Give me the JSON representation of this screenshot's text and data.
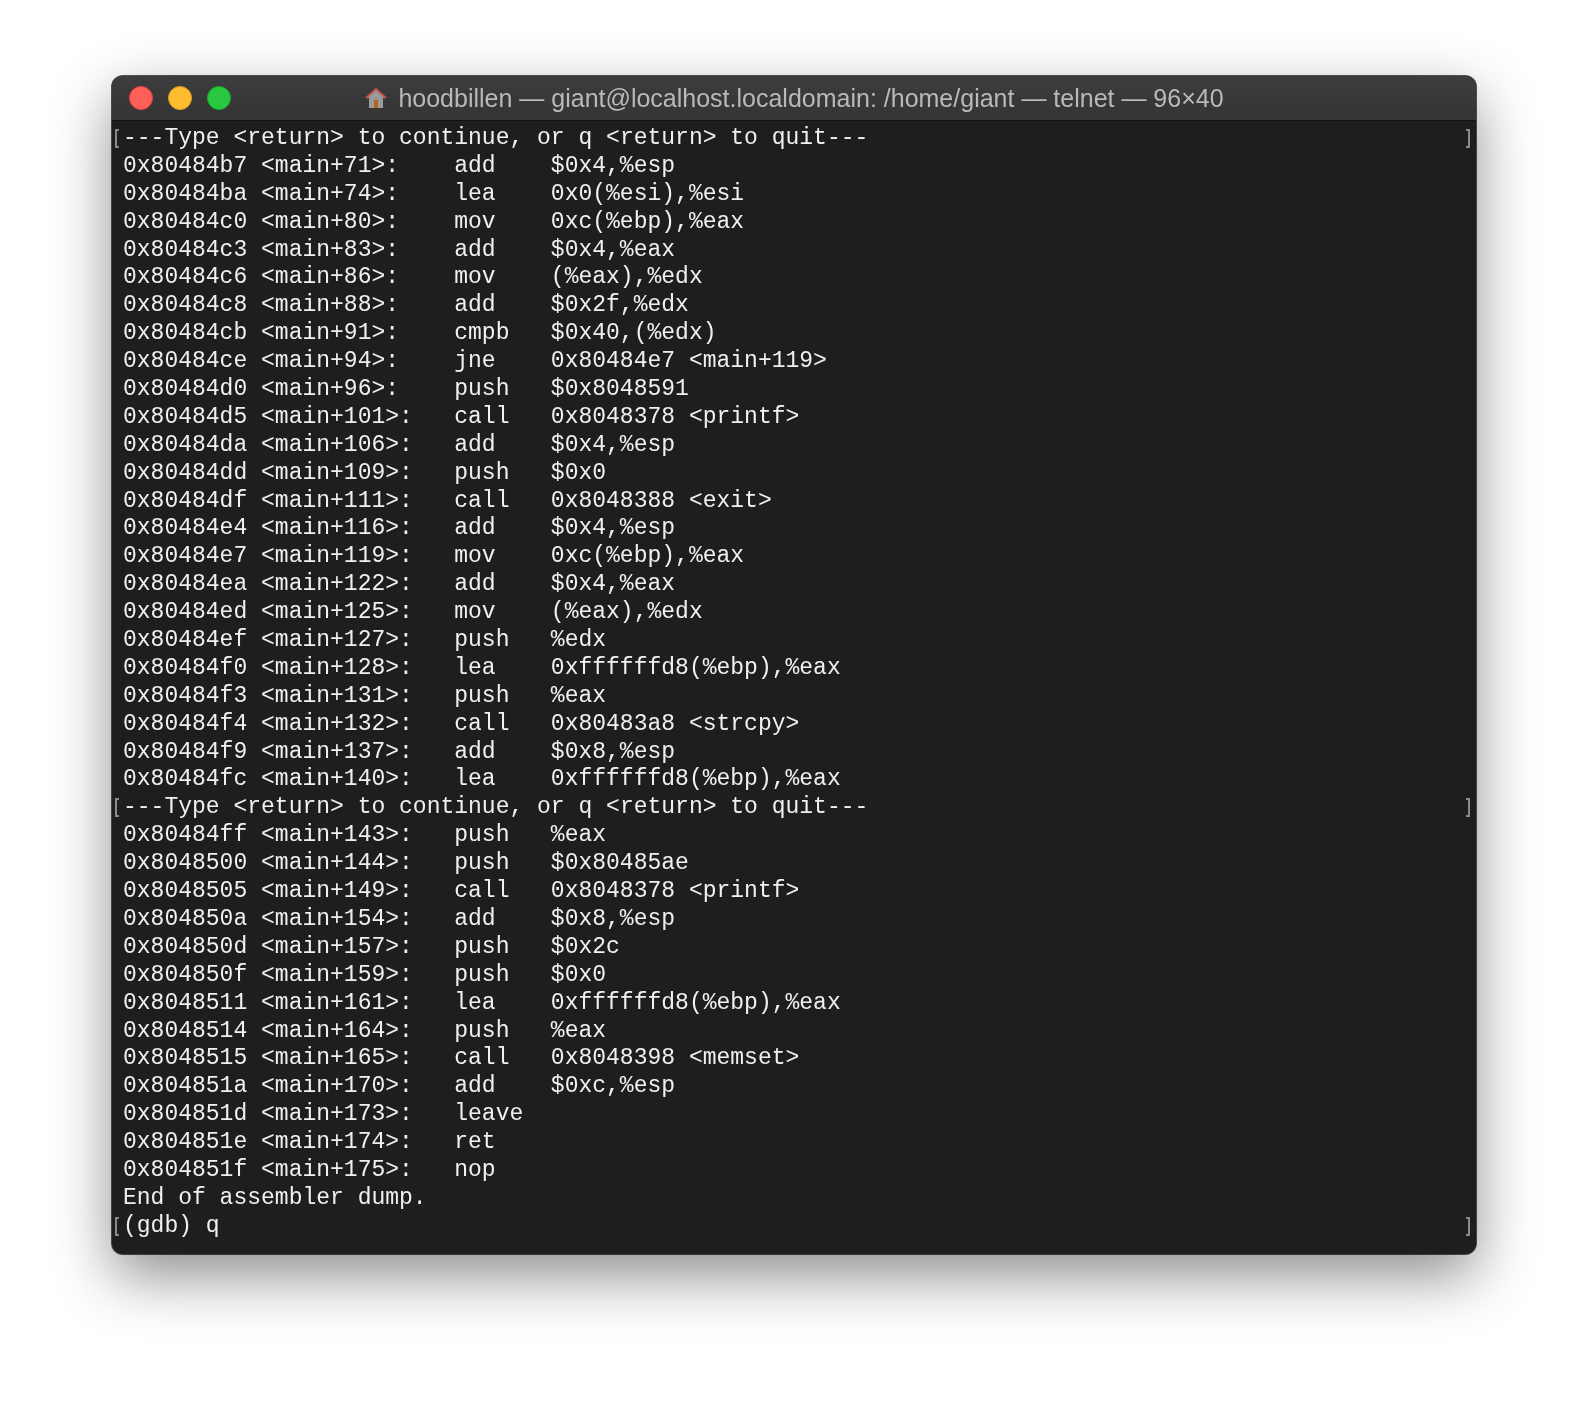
{
  "window": {
    "title": "hoodbillen — giant@localhost.localdomain: /home/giant — telnet — 96×40"
  },
  "lines": [
    {
      "kind": "text",
      "text": "---Type <return> to continue, or q <return> to quit---",
      "marked": true
    },
    {
      "kind": "instruction",
      "address": "0x80484b7 <main+71>:",
      "op": "add",
      "args": "$0x4,%esp"
    },
    {
      "kind": "instruction",
      "address": "0x80484ba <main+74>:",
      "op": "lea",
      "args": "0x0(%esi),%esi"
    },
    {
      "kind": "instruction",
      "address": "0x80484c0 <main+80>:",
      "op": "mov",
      "args": "0xc(%ebp),%eax"
    },
    {
      "kind": "instruction",
      "address": "0x80484c3 <main+83>:",
      "op": "add",
      "args": "$0x4,%eax"
    },
    {
      "kind": "instruction",
      "address": "0x80484c6 <main+86>:",
      "op": "mov",
      "args": "(%eax),%edx"
    },
    {
      "kind": "instruction",
      "address": "0x80484c8 <main+88>:",
      "op": "add",
      "args": "$0x2f,%edx"
    },
    {
      "kind": "instruction",
      "address": "0x80484cb <main+91>:",
      "op": "cmpb",
      "args": "$0x40,(%edx)"
    },
    {
      "kind": "instruction",
      "address": "0x80484ce <main+94>:",
      "op": "jne",
      "args": "0x80484e7 <main+119>"
    },
    {
      "kind": "instruction",
      "address": "0x80484d0 <main+96>:",
      "op": "push",
      "args": "$0x8048591"
    },
    {
      "kind": "instruction",
      "address": "0x80484d5 <main+101>:",
      "op": "call",
      "args": "0x8048378 <printf>"
    },
    {
      "kind": "instruction",
      "address": "0x80484da <main+106>:",
      "op": "add",
      "args": "$0x4,%esp"
    },
    {
      "kind": "instruction",
      "address": "0x80484dd <main+109>:",
      "op": "push",
      "args": "$0x0"
    },
    {
      "kind": "instruction",
      "address": "0x80484df <main+111>:",
      "op": "call",
      "args": "0x8048388 <exit>"
    },
    {
      "kind": "instruction",
      "address": "0x80484e4 <main+116>:",
      "op": "add",
      "args": "$0x4,%esp"
    },
    {
      "kind": "instruction",
      "address": "0x80484e7 <main+119>:",
      "op": "mov",
      "args": "0xc(%ebp),%eax"
    },
    {
      "kind": "instruction",
      "address": "0x80484ea <main+122>:",
      "op": "add",
      "args": "$0x4,%eax"
    },
    {
      "kind": "instruction",
      "address": "0x80484ed <main+125>:",
      "op": "mov",
      "args": "(%eax),%edx"
    },
    {
      "kind": "instruction",
      "address": "0x80484ef <main+127>:",
      "op": "push",
      "args": "%edx"
    },
    {
      "kind": "instruction",
      "address": "0x80484f0 <main+128>:",
      "op": "lea",
      "args": "0xffffffd8(%ebp),%eax"
    },
    {
      "kind": "instruction",
      "address": "0x80484f3 <main+131>:",
      "op": "push",
      "args": "%eax"
    },
    {
      "kind": "instruction",
      "address": "0x80484f4 <main+132>:",
      "op": "call",
      "args": "0x80483a8 <strcpy>"
    },
    {
      "kind": "instruction",
      "address": "0x80484f9 <main+137>:",
      "op": "add",
      "args": "$0x8,%esp"
    },
    {
      "kind": "instruction",
      "address": "0x80484fc <main+140>:",
      "op": "lea",
      "args": "0xffffffd8(%ebp),%eax"
    },
    {
      "kind": "text",
      "text": "---Type <return> to continue, or q <return> to quit---",
      "marked": true
    },
    {
      "kind": "instruction",
      "address": "0x80484ff <main+143>:",
      "op": "push",
      "args": "%eax"
    },
    {
      "kind": "instruction",
      "address": "0x8048500 <main+144>:",
      "op": "push",
      "args": "$0x80485ae"
    },
    {
      "kind": "instruction",
      "address": "0x8048505 <main+149>:",
      "op": "call",
      "args": "0x8048378 <printf>"
    },
    {
      "kind": "instruction",
      "address": "0x804850a <main+154>:",
      "op": "add",
      "args": "$0x8,%esp"
    },
    {
      "kind": "instruction",
      "address": "0x804850d <main+157>:",
      "op": "push",
      "args": "$0x2c"
    },
    {
      "kind": "instruction",
      "address": "0x804850f <main+159>:",
      "op": "push",
      "args": "$0x0"
    },
    {
      "kind": "instruction",
      "address": "0x8048511 <main+161>:",
      "op": "lea",
      "args": "0xffffffd8(%ebp),%eax"
    },
    {
      "kind": "instruction",
      "address": "0x8048514 <main+164>:",
      "op": "push",
      "args": "%eax"
    },
    {
      "kind": "instruction",
      "address": "0x8048515 <main+165>:",
      "op": "call",
      "args": "0x8048398 <memset>"
    },
    {
      "kind": "instruction",
      "address": "0x804851a <main+170>:",
      "op": "add",
      "args": "$0xc,%esp"
    },
    {
      "kind": "instruction",
      "address": "0x804851d <main+173>:",
      "op": "leave"
    },
    {
      "kind": "instruction",
      "address": "0x804851e <main+174>:",
      "op": "ret"
    },
    {
      "kind": "instruction",
      "address": "0x804851f <main+175>:",
      "op": "nop"
    },
    {
      "kind": "text",
      "text": "End of assembler dump.",
      "marked": false
    },
    {
      "kind": "text",
      "text": "(gdb) q",
      "marked": true
    }
  ]
}
